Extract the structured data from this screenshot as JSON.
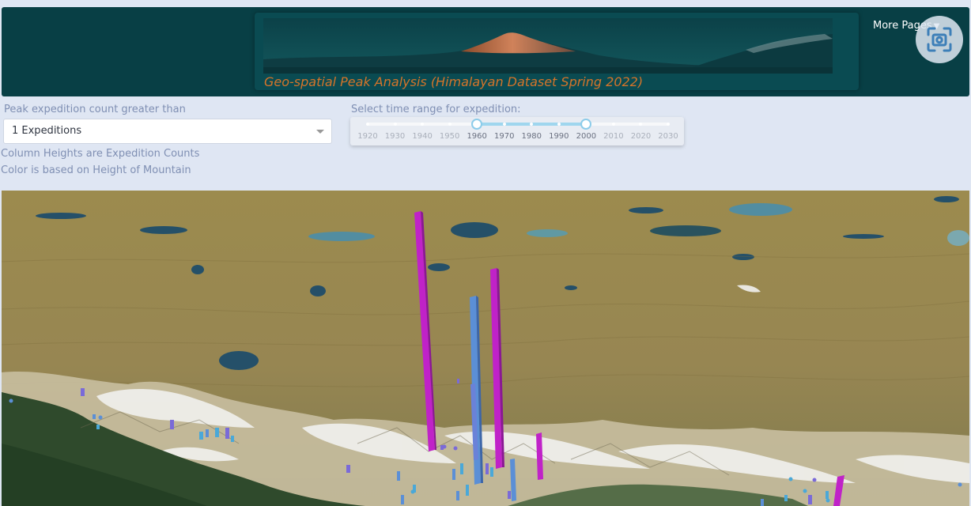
{
  "header": {
    "title": "Geo-spatial Peak Analysis (Himalayan Dataset Spring 2022)",
    "more_pages": "More Pages",
    "caret_icon": "caret-down-icon",
    "screenshot_icon": "screenshot-icon"
  },
  "filters": {
    "expedition_label": "Peak expedition count greater than",
    "expedition_value": "1 Expeditions",
    "note_heights": "Column Heights are Expedition Counts",
    "note_color": "Color is based on Height of Mountain"
  },
  "time_range": {
    "label": "Select time range for expedition:",
    "marks": [
      "1920",
      "1930",
      "1940",
      "1950",
      "1960",
      "1970",
      "1980",
      "1990",
      "2000",
      "2010",
      "2020",
      "2030"
    ],
    "selected_start": "1960",
    "selected_end": "2000"
  },
  "map": {
    "colors": {
      "terrain": "#9a8a4c",
      "snow": "#f2f2f0",
      "forest": "#2f4a2c",
      "lake": "#1f4a68",
      "tall_peak": "#c022c8",
      "mid_peak": "#5b8fd6",
      "low_peak": "#4aa8d8"
    }
  }
}
